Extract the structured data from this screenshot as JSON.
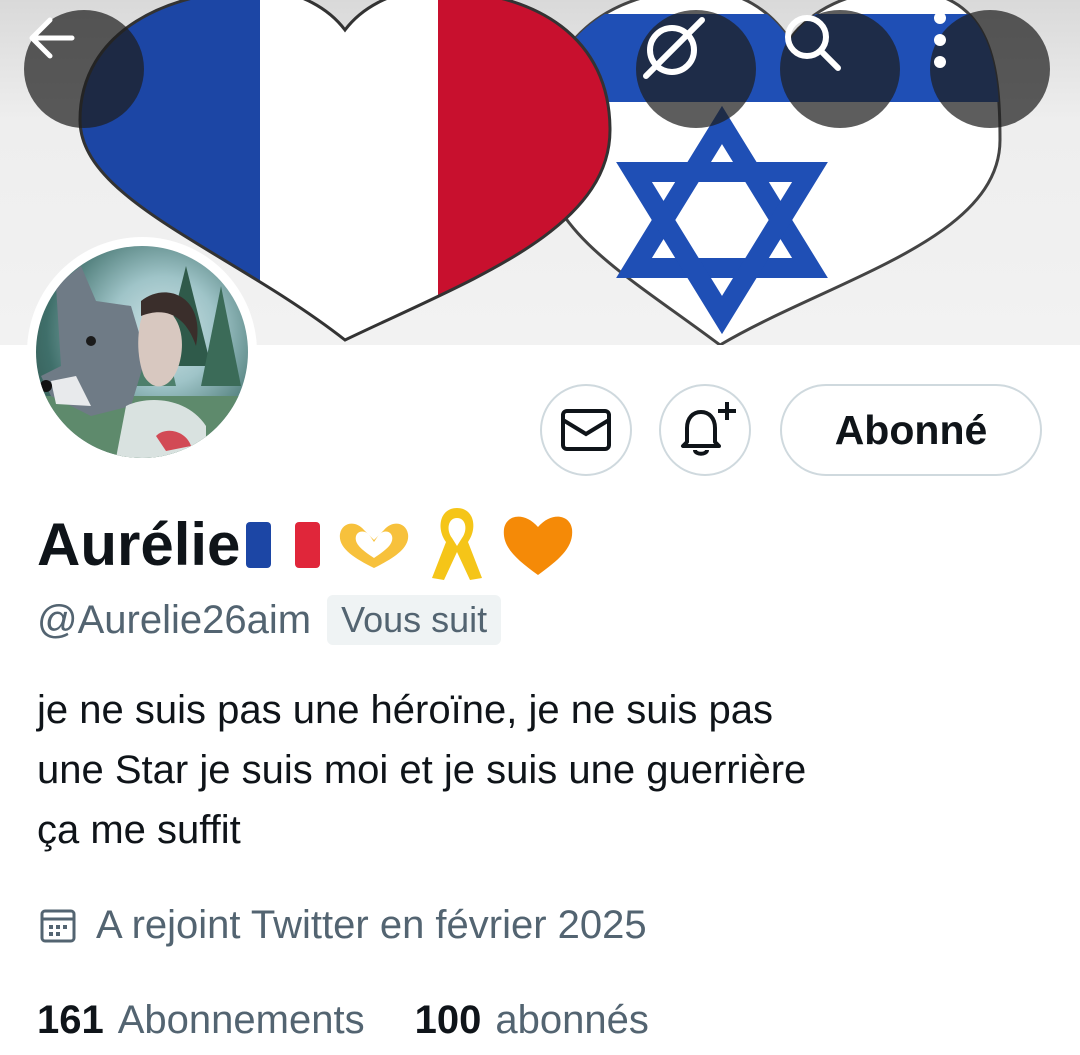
{
  "header": {
    "back_icon": "arrow-left-icon",
    "grok_icon": "grok-icon",
    "search_icon": "search-icon",
    "more_icon": "more-vertical-icon",
    "banner": "heart-flags-france-israel"
  },
  "profile": {
    "display_name": "Aurélie",
    "name_emojis": [
      "flag-france",
      "heart-hands",
      "yellow-ribbon",
      "orange-heart"
    ],
    "handle": "@Aurelie26aim",
    "follows_you_badge": "Vous suit",
    "bio_lines": [
      "je ne suis pas une héroïne, je ne suis pas",
      "une Star je suis moi et je suis une guerrière",
      "ça me suffit"
    ],
    "joined": "A rejoint Twitter en février 2025",
    "following_count": "161",
    "following_label": "Abonnements",
    "followers_count": "100",
    "followers_label": "abonnés"
  },
  "actions": {
    "message_icon": "mail-icon",
    "notify_icon": "bell-plus-icon",
    "follow_label": "Abonné"
  },
  "colors": {
    "text_primary": "#0f1419",
    "text_secondary": "#536471",
    "border": "#cfd9de",
    "badge_bg": "#eff3f4",
    "flag_blue": "#1c46a5",
    "flag_red": "#c8102e",
    "israel_blue": "#1f4fb5"
  }
}
